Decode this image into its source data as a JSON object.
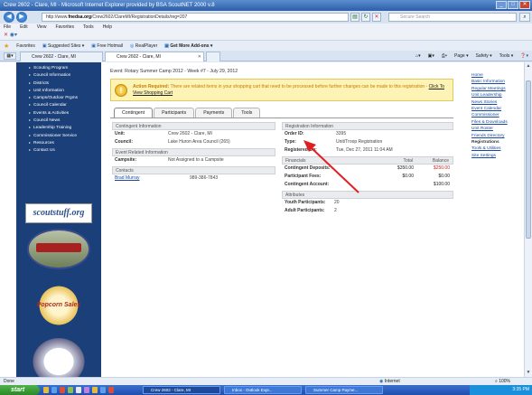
{
  "browser": {
    "window_title": "Crew 2602 - Clare, MI - Microsoft Internet Explorer provided by BSA ScoutNET 2000 v.8",
    "url_prefix": "http://www.",
    "url_domain": "fnedsa.org",
    "url_rest": "/Crew2602/ClareMI/RegistrationDetails/reg=207",
    "search_placeholder": "Secure Search",
    "menu": [
      "File",
      "Edit",
      "View",
      "Favorites",
      "Tools",
      "Help"
    ],
    "favorites_label": "Favorites",
    "fav_links": [
      "Suggested Sites ▾",
      "Free Hotmail",
      "RealPlayer",
      "Get More Add-ons ▾"
    ],
    "tabs": [
      {
        "label": "Crew 2602 - Clare, MI"
      },
      {
        "label": "Crew 2602 - Clare, MI"
      }
    ],
    "commands": [
      "Page ▾",
      "Safety ▾",
      "Tools ▾"
    ],
    "status_left": "Done",
    "status_zone": "Internet",
    "status_zoom": "100%"
  },
  "sidebar": {
    "items": [
      "Scouting Program",
      "Council Information",
      "Districts",
      "Unit Information",
      "Camps/Outdoor Prgms",
      "Council Calendar",
      "Events & Activities",
      "Council News",
      "Leadership Training",
      "Commissioner Service",
      "Resources",
      "Contact Us"
    ],
    "scoutstuff_logo": "scoutstuff.org",
    "popcorn_label": "Popcorn Sales"
  },
  "event": {
    "title": "Event: Rotary Summer Camp 2012 - Week #7 - July 29, 2012",
    "alert_strong": "Action Required:",
    "alert_text": " There are related items in your shopping cart that need to be processed before further changes can be made to this registration - ",
    "alert_link": "Click To View Shopping Cart"
  },
  "tabs": [
    "Contingent",
    "Participants",
    "Payments",
    "Tools"
  ],
  "contingent": {
    "header": "Contingent Information",
    "unit_label": "Unit:",
    "unit_value": "Crew 2602 - Clare, MI",
    "council_label": "Council:",
    "council_value": "Lake Huron Area Council (265)"
  },
  "event_related": {
    "header": "Event Related Information",
    "campsite_label": "Campsite:",
    "campsite_value": "Not Assigned to a Campsite"
  },
  "contacts": {
    "header": "Contacts",
    "name": "Brad Murray",
    "phone": "989-386-7843"
  },
  "registration": {
    "header": "Registration Information",
    "order_label": "Order ID:",
    "order_value": "3395",
    "type_label": "Type:",
    "type_value": "Unit/Troop Registration",
    "registered_label": "Registered On:",
    "registered_value": "Tue, Dec 27, 2011 11:04 AM"
  },
  "financials": {
    "header": "Financials",
    "col_total": "Total",
    "col_balance": "Balance",
    "rows": [
      {
        "label": "Contingent Deposits:",
        "total": "$350.00",
        "balance": "$250.00"
      },
      {
        "label": "Participant Fees:",
        "total": "$0.00",
        "balance": "$0.00"
      },
      {
        "label": "Contingent Account:",
        "total": "",
        "balance": "$100.00"
      }
    ]
  },
  "attributes": {
    "header": "Attributes",
    "youth_label": "Youth Participants:",
    "youth_value": "20",
    "adult_label": "Adult Participants:",
    "adult_value": "2"
  },
  "rightnav": {
    "items": [
      "Home",
      "Basic Information",
      "Regular Meetings",
      "Unit Leadership",
      "News Stories",
      "Event Calendar",
      "Commissioner",
      "Files & Downloads",
      "Unit Roster",
      "Friends Directory",
      "Registrations",
      "Tools & Utilities",
      "Site Settings"
    ]
  },
  "taskbar": {
    "start": "start",
    "tasks": [
      "Crew 2602 - Clare, MI",
      "Inbox - Outlook Expr...",
      "Summer Camp Payme..."
    ],
    "clock": "3:35 PM"
  },
  "colors": {
    "nav_blue": "#1b3f78",
    "alert_bg": "#fdf3b5",
    "alert_text": "#c57b00",
    "balance_red": "#d22222",
    "arrow_red": "#e02020"
  }
}
